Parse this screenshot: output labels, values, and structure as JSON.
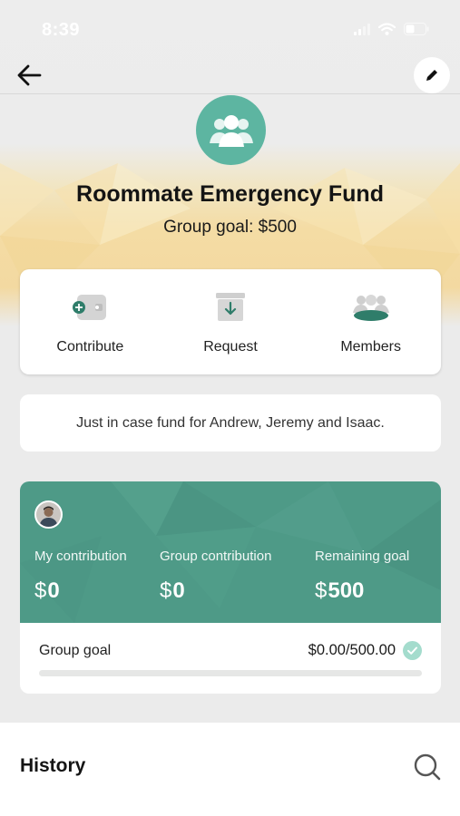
{
  "status_bar": {
    "time": "8:39"
  },
  "nav": {
    "back_icon": "arrow-left-icon",
    "edit_icon": "pencil-icon"
  },
  "group": {
    "avatar_icon": "group-people-icon",
    "title": "Roommate Emergency Fund",
    "goal_text": "Group goal: $500",
    "description": "Just in case fund for Andrew, Jeremy and Isaac."
  },
  "actions": [
    {
      "label": "Contribute",
      "icon": "wallet-add-icon"
    },
    {
      "label": "Request",
      "icon": "inbox-download-icon"
    },
    {
      "label": "Members",
      "icon": "members-icon"
    }
  ],
  "stats": {
    "my_contribution": {
      "label": "My contribution",
      "currency": "$",
      "amount": "0"
    },
    "group_contribution": {
      "label": "Group contribution",
      "currency": "$",
      "amount": "0"
    },
    "remaining_goal": {
      "label": "Remaining goal",
      "currency": "$",
      "amount": "500"
    },
    "goal_label": "Group goal",
    "goal_amount": "$0.00/500.00",
    "progress": 0
  },
  "history": {
    "title": "History",
    "search_icon": "search-icon"
  },
  "colors": {
    "accent": "#5db5a1",
    "card_green": "#4e9a87",
    "banner_gold": "#f3d9a1"
  }
}
